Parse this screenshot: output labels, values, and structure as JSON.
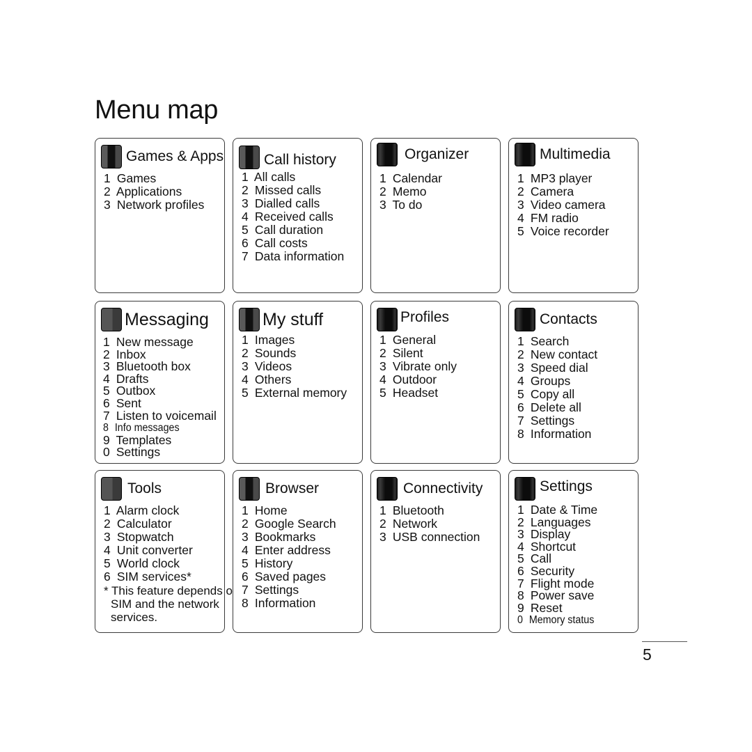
{
  "page": {
    "title": "Menu map",
    "page_number": "5"
  },
  "menus": [
    {
      "title": "Games & Apps",
      "icon": "games-apps-icon",
      "items": [
        {
          "num": "1",
          "label": "Games"
        },
        {
          "num": "2",
          "label": "Applications"
        },
        {
          "num": "3",
          "label": "Network profiles"
        }
      ]
    },
    {
      "title": "Call history",
      "icon": "call-history-icon",
      "items": [
        {
          "num": "1",
          "label": "All calls"
        },
        {
          "num": "2",
          "label": "Missed calls"
        },
        {
          "num": "3",
          "label": "Dialled calls"
        },
        {
          "num": "4",
          "label": "Received calls"
        },
        {
          "num": "5",
          "label": "Call duration"
        },
        {
          "num": "6",
          "label": "Call costs"
        },
        {
          "num": "7",
          "label": "Data information"
        }
      ]
    },
    {
      "title": "Organizer",
      "icon": "organizer-icon",
      "items": [
        {
          "num": "1",
          "label": "Calendar"
        },
        {
          "num": "2",
          "label": "Memo"
        },
        {
          "num": "3",
          "label": "To do"
        }
      ]
    },
    {
      "title": "Multimedia",
      "icon": "multimedia-icon",
      "items": [
        {
          "num": "1",
          "label": "MP3 player"
        },
        {
          "num": "2",
          "label": "Camera"
        },
        {
          "num": "3",
          "label": "Video camera"
        },
        {
          "num": "4",
          "label": "FM radio"
        },
        {
          "num": "5",
          "label": "Voice recorder"
        }
      ]
    },
    {
      "title": "Messaging",
      "icon": "messaging-icon",
      "items": [
        {
          "num": "1",
          "label": "New message"
        },
        {
          "num": "2",
          "label": "Inbox"
        },
        {
          "num": "3",
          "label": "Bluetooth box"
        },
        {
          "num": "4",
          "label": "Drafts"
        },
        {
          "num": "5",
          "label": "Outbox"
        },
        {
          "num": "6",
          "label": "Sent"
        },
        {
          "num": "7",
          "label": "Listen to voicemail"
        },
        {
          "num": "8",
          "label": "Info messages"
        },
        {
          "num": "9",
          "label": "Templates"
        },
        {
          "num": "0",
          "label": "Settings"
        }
      ]
    },
    {
      "title": "My stuff",
      "icon": "my-stuff-icon",
      "items": [
        {
          "num": "1",
          "label": "Images"
        },
        {
          "num": "2",
          "label": "Sounds"
        },
        {
          "num": "3",
          "label": "Videos"
        },
        {
          "num": "4",
          "label": "Others"
        },
        {
          "num": "5",
          "label": "External memory"
        }
      ]
    },
    {
      "title": "Profiles",
      "icon": "profiles-icon",
      "items": [
        {
          "num": "1",
          "label": "General"
        },
        {
          "num": "2",
          "label": "Silent"
        },
        {
          "num": "3",
          "label": "Vibrate only"
        },
        {
          "num": "4",
          "label": "Outdoor"
        },
        {
          "num": "5",
          "label": "Headset"
        }
      ]
    },
    {
      "title": "Contacts",
      "icon": "contacts-icon",
      "items": [
        {
          "num": "1",
          "label": "Search"
        },
        {
          "num": "2",
          "label": "New contact"
        },
        {
          "num": "3",
          "label": "Speed dial"
        },
        {
          "num": "4",
          "label": "Groups"
        },
        {
          "num": "5",
          "label": "Copy all"
        },
        {
          "num": "6",
          "label": "Delete all"
        },
        {
          "num": "7",
          "label": "Settings"
        },
        {
          "num": "8",
          "label": "Information"
        }
      ]
    },
    {
      "title": "Tools",
      "icon": "tools-icon",
      "items": [
        {
          "num": "1",
          "label": "Alarm clock"
        },
        {
          "num": "2",
          "label": "Calculator"
        },
        {
          "num": "3",
          "label": "Stopwatch"
        },
        {
          "num": "4",
          "label": "Unit converter"
        },
        {
          "num": "5",
          "label": "World clock"
        },
        {
          "num": "6",
          "label": "SIM services*"
        }
      ],
      "note": {
        "line1": "* This feature depends on",
        "line2": "SIM and the network",
        "line3": "services."
      }
    },
    {
      "title": "Browser",
      "icon": "browser-icon",
      "items": [
        {
          "num": "1",
          "label": "Home"
        },
        {
          "num": "2",
          "label": "Google Search"
        },
        {
          "num": "3",
          "label": "Bookmarks"
        },
        {
          "num": "4",
          "label": "Enter address"
        },
        {
          "num": "5",
          "label": "History"
        },
        {
          "num": "6",
          "label": "Saved pages"
        },
        {
          "num": "7",
          "label": "Settings"
        },
        {
          "num": "8",
          "label": "Information"
        }
      ]
    },
    {
      "title": "Connectivity",
      "icon": "connectivity-icon",
      "items": [
        {
          "num": "1",
          "label": "Bluetooth"
        },
        {
          "num": "2",
          "label": "Network"
        },
        {
          "num": "3",
          "label": "USB connection"
        }
      ]
    },
    {
      "title": "Settings",
      "icon": "settings-icon",
      "items": [
        {
          "num": "1",
          "label": "Date & Time"
        },
        {
          "num": "2",
          "label": "Languages"
        },
        {
          "num": "3",
          "label": "Display"
        },
        {
          "num": "4",
          "label": "Shortcut"
        },
        {
          "num": "5",
          "label": "Call"
        },
        {
          "num": "6",
          "label": "Security"
        },
        {
          "num": "7",
          "label": "Flight mode"
        },
        {
          "num": "8",
          "label": "Power save"
        },
        {
          "num": "9",
          "label": "Reset"
        },
        {
          "num": "0",
          "label": "Memory status"
        }
      ]
    }
  ]
}
